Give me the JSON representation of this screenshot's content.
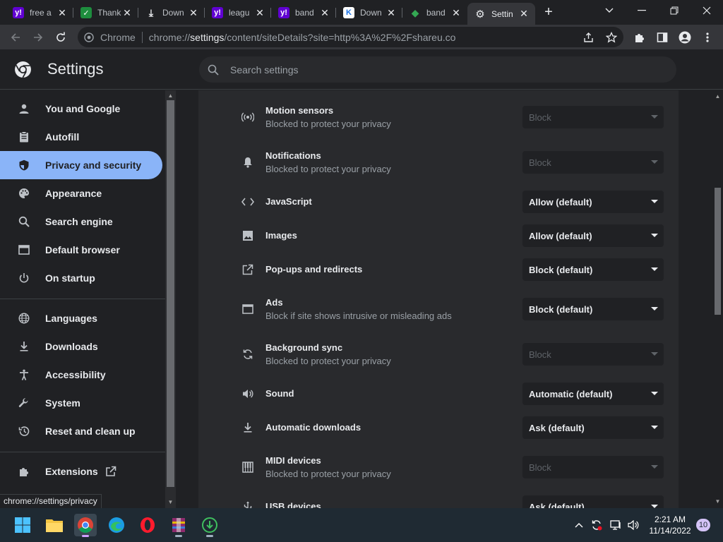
{
  "tabs": [
    {
      "title": "free a",
      "favicon": "yahoo-icon",
      "favicon_color": "#6001d2",
      "favicon_glyph": "y!"
    },
    {
      "title": "Thank",
      "favicon": "green-check-icon",
      "favicon_color": "#1e8e3e",
      "favicon_glyph": "✓"
    },
    {
      "title": "Down",
      "favicon": "download-icon",
      "favicon_color": "",
      "favicon_glyph": "⤓"
    },
    {
      "title": "leagu",
      "favicon": "yahoo-icon",
      "favicon_color": "#6001d2",
      "favicon_glyph": "y!"
    },
    {
      "title": "band",
      "favicon": "yahoo-icon",
      "favicon_color": "#6001d2",
      "favicon_glyph": "y!"
    },
    {
      "title": "Down",
      "favicon": "k-site-icon",
      "favicon_color": "#ffffff",
      "favicon_glyph": "K"
    },
    {
      "title": "band",
      "favicon": "shield-site-icon",
      "favicon_color": "#34a853",
      "favicon_glyph": "◆"
    },
    {
      "title": "Settin",
      "favicon": "gear-icon",
      "favicon_color": "",
      "favicon_glyph": "⚙"
    }
  ],
  "omnibox": {
    "chip": "Chrome",
    "url_prefix": "chrome://",
    "url_host": "settings",
    "url_path": "/content/siteDetails?site=http%3A%2F%2Fshareu.co"
  },
  "header": {
    "title": "Settings",
    "search_placeholder": "Search settings"
  },
  "sidebar": {
    "items": [
      {
        "label": "You and Google",
        "icon": "person-icon"
      },
      {
        "label": "Autofill",
        "icon": "clipboard-icon"
      },
      {
        "label": "Privacy and security",
        "icon": "shield-icon"
      },
      {
        "label": "Appearance",
        "icon": "palette-icon"
      },
      {
        "label": "Search engine",
        "icon": "search-icon"
      },
      {
        "label": "Default browser",
        "icon": "browser-icon"
      },
      {
        "label": "On startup",
        "icon": "power-icon"
      },
      {
        "label": "Languages",
        "icon": "globe-icon"
      },
      {
        "label": "Downloads",
        "icon": "download-icon"
      },
      {
        "label": "Accessibility",
        "icon": "accessibility-icon"
      },
      {
        "label": "System",
        "icon": "wrench-icon"
      },
      {
        "label": "Reset and clean up",
        "icon": "history-icon"
      },
      {
        "label": "Extensions",
        "icon": "puzzle-icon"
      }
    ],
    "active": "Privacy and security"
  },
  "permissions": [
    {
      "label": "Motion sensors",
      "sub": "Blocked to protect your privacy",
      "value": "Block",
      "disabled": true,
      "icon": "sensors-icon"
    },
    {
      "label": "Notifications",
      "sub": "Blocked to protect your privacy",
      "value": "Block",
      "disabled": true,
      "icon": "bell-icon"
    },
    {
      "label": "JavaScript",
      "sub": "",
      "value": "Allow (default)",
      "disabled": false,
      "icon": "code-icon"
    },
    {
      "label": "Images",
      "sub": "",
      "value": "Allow (default)",
      "disabled": false,
      "icon": "image-icon"
    },
    {
      "label": "Pop-ups and redirects",
      "sub": "",
      "value": "Block (default)",
      "disabled": false,
      "icon": "open-external-icon"
    },
    {
      "label": "Ads",
      "sub": "Block if site shows intrusive or misleading ads",
      "value": "Block (default)",
      "disabled": false,
      "icon": "ad-window-icon"
    },
    {
      "label": "Background sync",
      "sub": "Blocked to protect your privacy",
      "value": "Block",
      "disabled": true,
      "icon": "sync-icon"
    },
    {
      "label": "Sound",
      "sub": "",
      "value": "Automatic (default)",
      "disabled": false,
      "icon": "speaker-icon"
    },
    {
      "label": "Automatic downloads",
      "sub": "",
      "value": "Ask (default)",
      "disabled": false,
      "icon": "download-icon"
    },
    {
      "label": "MIDI devices",
      "sub": "Blocked to protect your privacy",
      "value": "Block",
      "disabled": true,
      "icon": "piano-icon"
    },
    {
      "label": "USB devices",
      "sub": "",
      "value": "Ask (default)",
      "disabled": false,
      "icon": "usb-icon"
    }
  ],
  "status_url": "chrome://settings/privacy",
  "taskbar": {
    "time": "2:21 AM",
    "date": "11/14/2022",
    "notifications": "10"
  },
  "colors": {
    "accent": "#8ab4f8",
    "background": "#202124",
    "card": "#292a2d"
  }
}
